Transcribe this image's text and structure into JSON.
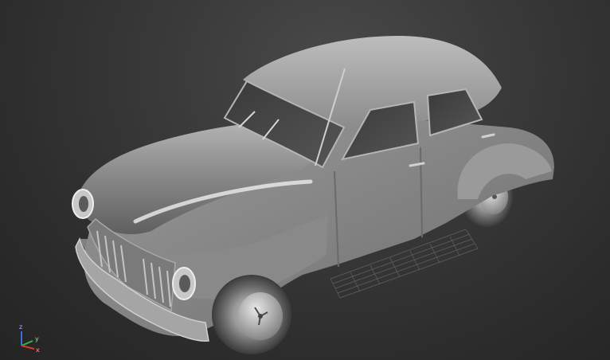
{
  "viewport": {
    "label": "' ' '   ' '   ' ' '",
    "object_name": "car-sedan-model",
    "shading": "clay-grey"
  },
  "gizmo": {
    "x_label": "x",
    "y_label": "y",
    "z_label": "z",
    "colors": {
      "x": "#d23a2f",
      "y": "#39b54a",
      "z": "#3d6fd6"
    }
  },
  "colors": {
    "background": "#2b2b2b",
    "car_body": "#8f8f8f",
    "grid": "#6a6a6a"
  }
}
